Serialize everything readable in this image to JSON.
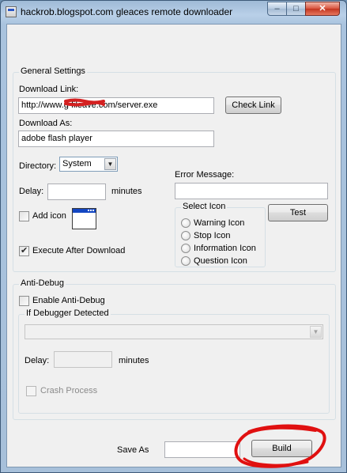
{
  "window": {
    "title": "hackrob.blogspot.com gleaces remote downloader",
    "min_label": "–",
    "max_label": "□",
    "close_label": "✕"
  },
  "general": {
    "title": "General Settings",
    "download_link_label": "Download Link:",
    "download_link_value": "http://www.g          fileave.com/server.exe",
    "check_link_label": "Check Link",
    "download_as_label": "Download As:",
    "download_as_value": "adobe flash player",
    "directory_label": "Directory:",
    "directory_value": "System",
    "delay_label": "Delay:",
    "delay_value": "",
    "minutes_label": "minutes",
    "error_message_label": "Error Message:",
    "error_message_value": "",
    "add_icon_label": "Add icon",
    "test_label": "Test",
    "execute_after_download_label": "Execute After Download",
    "select_icon": {
      "title": "Select Icon",
      "options": [
        "Warning Icon",
        "Stop Icon",
        "Information Icon",
        "Question Icon"
      ]
    }
  },
  "anti_debug": {
    "title": "Anti-Debug",
    "enable_label": "Enable Anti-Debug",
    "if_debugger_title": "If Debugger Detected",
    "action_value": "",
    "delay_label": "Delay:",
    "delay_value": "",
    "minutes_label": "minutes",
    "crash_process_label": "Crash Process"
  },
  "footer": {
    "save_as_label": "Save As",
    "save_as_value": "",
    "build_label": "Build"
  },
  "colors": {
    "redaction": "#d42020",
    "annotation": "#e01010"
  }
}
